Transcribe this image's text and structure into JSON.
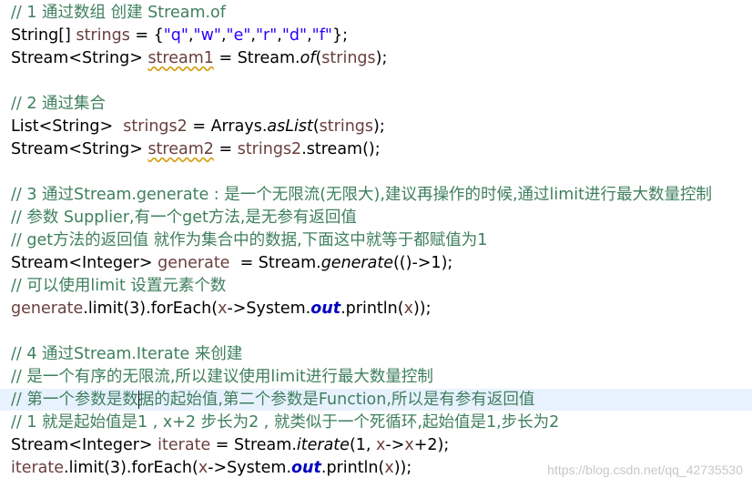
{
  "colors": {
    "background": "#ffffff",
    "comment": "#3f7f5f",
    "string": "#2a00ff",
    "variable": "#6a3e3e",
    "field": "#0000c0",
    "current_line": "#e8f2fe",
    "plain": "#000000"
  },
  "highlighted_line": 17,
  "caret": {
    "line": 17,
    "after_token": 0,
    "char_index": 10
  },
  "lines": [
    [
      {
        "t": "// 1 通过数组 创建 Stream.of",
        "c": "comment"
      }
    ],
    [
      {
        "t": "String[] ",
        "c": "plain"
      },
      {
        "t": "strings",
        "c": "var"
      },
      {
        "t": " = {",
        "c": "plain"
      },
      {
        "t": "\"q\"",
        "c": "string"
      },
      {
        "t": ",",
        "c": "plain"
      },
      {
        "t": "\"w\"",
        "c": "string"
      },
      {
        "t": ",",
        "c": "plain"
      },
      {
        "t": "\"e\"",
        "c": "string"
      },
      {
        "t": ",",
        "c": "plain"
      },
      {
        "t": "\"r\"",
        "c": "string"
      },
      {
        "t": ",",
        "c": "plain"
      },
      {
        "t": "\"d\"",
        "c": "string"
      },
      {
        "t": ",",
        "c": "plain"
      },
      {
        "t": "\"f\"",
        "c": "string"
      },
      {
        "t": "};",
        "c": "plain"
      }
    ],
    [
      {
        "t": "Stream<String> ",
        "c": "plain"
      },
      {
        "t": "stream1",
        "c": "var unused"
      },
      {
        "t": " = Stream.",
        "c": "plain"
      },
      {
        "t": "of",
        "c": "static"
      },
      {
        "t": "(",
        "c": "plain"
      },
      {
        "t": "strings",
        "c": "var"
      },
      {
        "t": ");",
        "c": "plain"
      }
    ],
    [],
    [
      {
        "t": "// 2 通过集合",
        "c": "comment"
      }
    ],
    [
      {
        "t": "List<String>  ",
        "c": "plain"
      },
      {
        "t": "strings2",
        "c": "var"
      },
      {
        "t": " = Arrays.",
        "c": "plain"
      },
      {
        "t": "asList",
        "c": "static"
      },
      {
        "t": "(",
        "c": "plain"
      },
      {
        "t": "strings",
        "c": "var"
      },
      {
        "t": ");",
        "c": "plain"
      }
    ],
    [
      {
        "t": "Stream<String> ",
        "c": "plain"
      },
      {
        "t": "stream2",
        "c": "var unused"
      },
      {
        "t": " = ",
        "c": "plain"
      },
      {
        "t": "strings2",
        "c": "var"
      },
      {
        "t": ".stream();",
        "c": "plain"
      }
    ],
    [],
    [
      {
        "t": "// 3 通过Stream.generate : 是一个无限流(无限大),建议再操作的时候,通过limit进行最大数量控制",
        "c": "comment"
      }
    ],
    [
      {
        "t": "// 参数 Supplier,有一个get方法,是无参有返回值",
        "c": "comment"
      }
    ],
    [
      {
        "t": "// get方法的返回值 就作为集合中的数据,下面这中就等于都赋值为1",
        "c": "comment"
      }
    ],
    [
      {
        "t": "Stream<Integer> ",
        "c": "plain"
      },
      {
        "t": "generate",
        "c": "var"
      },
      {
        "t": "  = Stream.",
        "c": "plain"
      },
      {
        "t": "generate",
        "c": "static"
      },
      {
        "t": "(()->1);",
        "c": "plain"
      }
    ],
    [
      {
        "t": "// 可以使用limit 设置元素个数",
        "c": "comment"
      }
    ],
    [
      {
        "t": "generate",
        "c": "var"
      },
      {
        "t": ".limit(3).forEach(",
        "c": "plain"
      },
      {
        "t": "x",
        "c": "param"
      },
      {
        "t": "->System.",
        "c": "plain"
      },
      {
        "t": "out",
        "c": "field"
      },
      {
        "t": ".println(",
        "c": "plain"
      },
      {
        "t": "x",
        "c": "param"
      },
      {
        "t": "));",
        "c": "plain"
      }
    ],
    [],
    [
      {
        "t": "// 4 通过Stream.Iterate 来创建",
        "c": "comment"
      }
    ],
    [
      {
        "t": "// 是一个有序的无限流,所以建议使用limit进行最大数量控制",
        "c": "comment"
      }
    ],
    [
      {
        "t": "// 第一个参数是数据的起始值,第二个参数是Function,所以是有参有返回值",
        "c": "comment"
      }
    ],
    [
      {
        "t": "// 1 就是起始值是1 , x+2 步长为2 , 就类似于一个死循环,起始值是1,步长为2",
        "c": "comment"
      }
    ],
    [
      {
        "t": "Stream<Integer> ",
        "c": "plain"
      },
      {
        "t": "iterate",
        "c": "var"
      },
      {
        "t": " = Stream.",
        "c": "plain"
      },
      {
        "t": "iterate",
        "c": "static"
      },
      {
        "t": "(1, ",
        "c": "plain"
      },
      {
        "t": "x",
        "c": "param"
      },
      {
        "t": "->",
        "c": "plain"
      },
      {
        "t": "x",
        "c": "param"
      },
      {
        "t": "+2);",
        "c": "plain"
      }
    ],
    [
      {
        "t": "iterate",
        "c": "var"
      },
      {
        "t": ".limit(3).forEach(",
        "c": "plain"
      },
      {
        "t": "x",
        "c": "param"
      },
      {
        "t": "->System.",
        "c": "plain"
      },
      {
        "t": "out",
        "c": "field"
      },
      {
        "t": ".println(",
        "c": "plain"
      },
      {
        "t": "x",
        "c": "param"
      },
      {
        "t": "));",
        "c": "plain"
      }
    ]
  ],
  "watermark": "https://blog.csdn.net/qq_42735530"
}
